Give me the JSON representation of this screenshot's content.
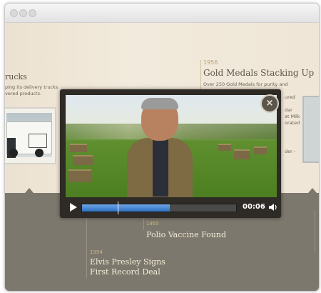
{
  "timeline": {
    "left_event": {
      "title_fragment": "rucks",
      "text_line1": "ping its delivery trucks",
      "text_line2": "vered products."
    },
    "right_event": {
      "year": "1956",
      "title": "Gold Medals Stacking Up",
      "text_line1": "Over 250 Gold Medals for purity and",
      "side_text": [
        "ured",
        "",
        "dar",
        "at Milk",
        "orated",
        "",
        "",
        "der -"
      ]
    },
    "band_events": [
      {
        "year": "1955",
        "title": "Polio Vaccine Found"
      },
      {
        "year": "1954",
        "title_line1": "Elvis Presley Signs",
        "title_line2": "First Record Deal"
      }
    ]
  },
  "video_player": {
    "close_label": "×",
    "time": "00:06",
    "progress": 0.57,
    "cursor": 0.23
  },
  "colors": {
    "accent_blue": "#2d6fc2",
    "gold": "#b8a16b",
    "band": "#7d786d"
  }
}
